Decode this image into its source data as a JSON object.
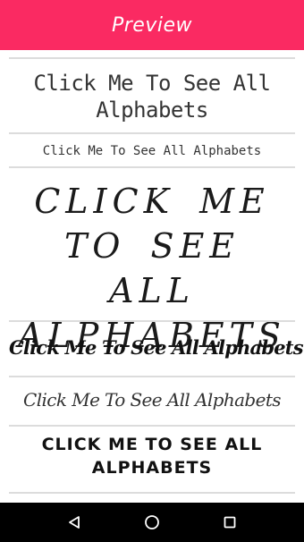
{
  "app_bar": {
    "title": "Preview",
    "color": "#fa2a62"
  },
  "preview_items": [
    {
      "text": "Click Me To See All Alphabets",
      "style": "handwritten-outline"
    },
    {
      "text": "Click Me To See All Alphabets",
      "style": "small-handwritten"
    },
    {
      "text": "CLICK ME TO SEE ALL ALPHABETS",
      "style": "script-capitals"
    },
    {
      "text": "Click Me To See All Alphabets",
      "style": "bold-brush-script"
    },
    {
      "text": "Click Me To See All Alphabets",
      "style": "light-script"
    },
    {
      "text": "Click me to See All Alphabets",
      "style": "bold-small-caps"
    }
  ],
  "nav_bar": {
    "back_icon": "back-triangle-icon",
    "home_icon": "home-circle-icon",
    "recents_icon": "recents-square-icon"
  }
}
